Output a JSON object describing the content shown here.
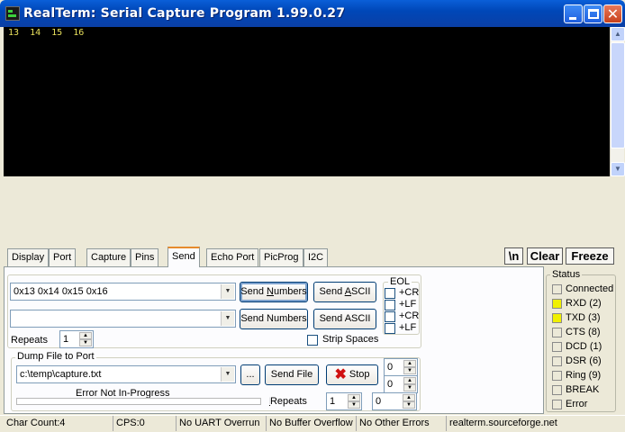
{
  "window": {
    "title": "RealTerm: Serial Capture Program 1.99.0.27",
    "close_glyph": "✕"
  },
  "terminal": {
    "text": "13  14  15  16"
  },
  "tabs": [
    {
      "label": "Display"
    },
    {
      "label": "Port"
    },
    {
      "label": "Capture"
    },
    {
      "label": "Pins"
    },
    {
      "label": "Send",
      "active": true
    },
    {
      "label": "Echo Port"
    },
    {
      "label": "PicProg"
    },
    {
      "label": "I2C"
    }
  ],
  "toolbar_right": {
    "newline": "\\n",
    "clear": "Clear",
    "freeze": "Freeze"
  },
  "send": {
    "combo1_value": "0x13 0x14 0x15 0x16",
    "combo2_value": "",
    "send_numbers_prefix": "Send ",
    "send_numbers_underlined": "N",
    "send_numbers_suffix": "umbers",
    "send_ascii_prefix": "Send ",
    "send_ascii_underlined": "A",
    "send_ascii_suffix": "SCII",
    "send_numbers_2": "Send Numbers",
    "send_ascii_2": "Send ASCII",
    "eol_title": "EOL",
    "eol_items": [
      "+CR",
      "+LF",
      "+CR",
      "+LF"
    ],
    "repeats_label": "Repeats",
    "repeats_value": "1",
    "strip_spaces_label": "Strip Spaces"
  },
  "dump": {
    "title": "Dump File to Port",
    "file_value": "c:\\temp\\capture.txt",
    "browse_label": "...",
    "send_file_label": "Send File",
    "stop_label": "Stop",
    "stop_icon": "✖",
    "status_text": "Error Not In-Progress",
    "repeats_label": "Repeats",
    "repeats_value": "1",
    "repeats_value2": "0",
    "spin1": "0",
    "spin2": "0"
  },
  "status_panel": {
    "title": "Status",
    "items": [
      {
        "label": "Connected",
        "on": false
      },
      {
        "label": "RXD (2)",
        "on": true
      },
      {
        "label": "TXD (3)",
        "on": true
      },
      {
        "label": "CTS (8)",
        "on": false
      },
      {
        "label": "DCD (1)",
        "on": false
      },
      {
        "label": "DSR (6)",
        "on": false
      },
      {
        "label": "Ring (9)",
        "on": false
      },
      {
        "label": "BREAK",
        "on": false
      },
      {
        "label": "Error",
        "on": false
      }
    ],
    "colors": {
      "led_on": "#f0f000",
      "led_off": "#ece9d8"
    }
  },
  "statusbar": {
    "char_count": "Char Count:4",
    "cps": "CPS:0",
    "uart": "No UART Overrun",
    "buffer": "No Buffer Overflow",
    "errors": "No Other Errors",
    "site": "realterm.sourceforge.net"
  }
}
